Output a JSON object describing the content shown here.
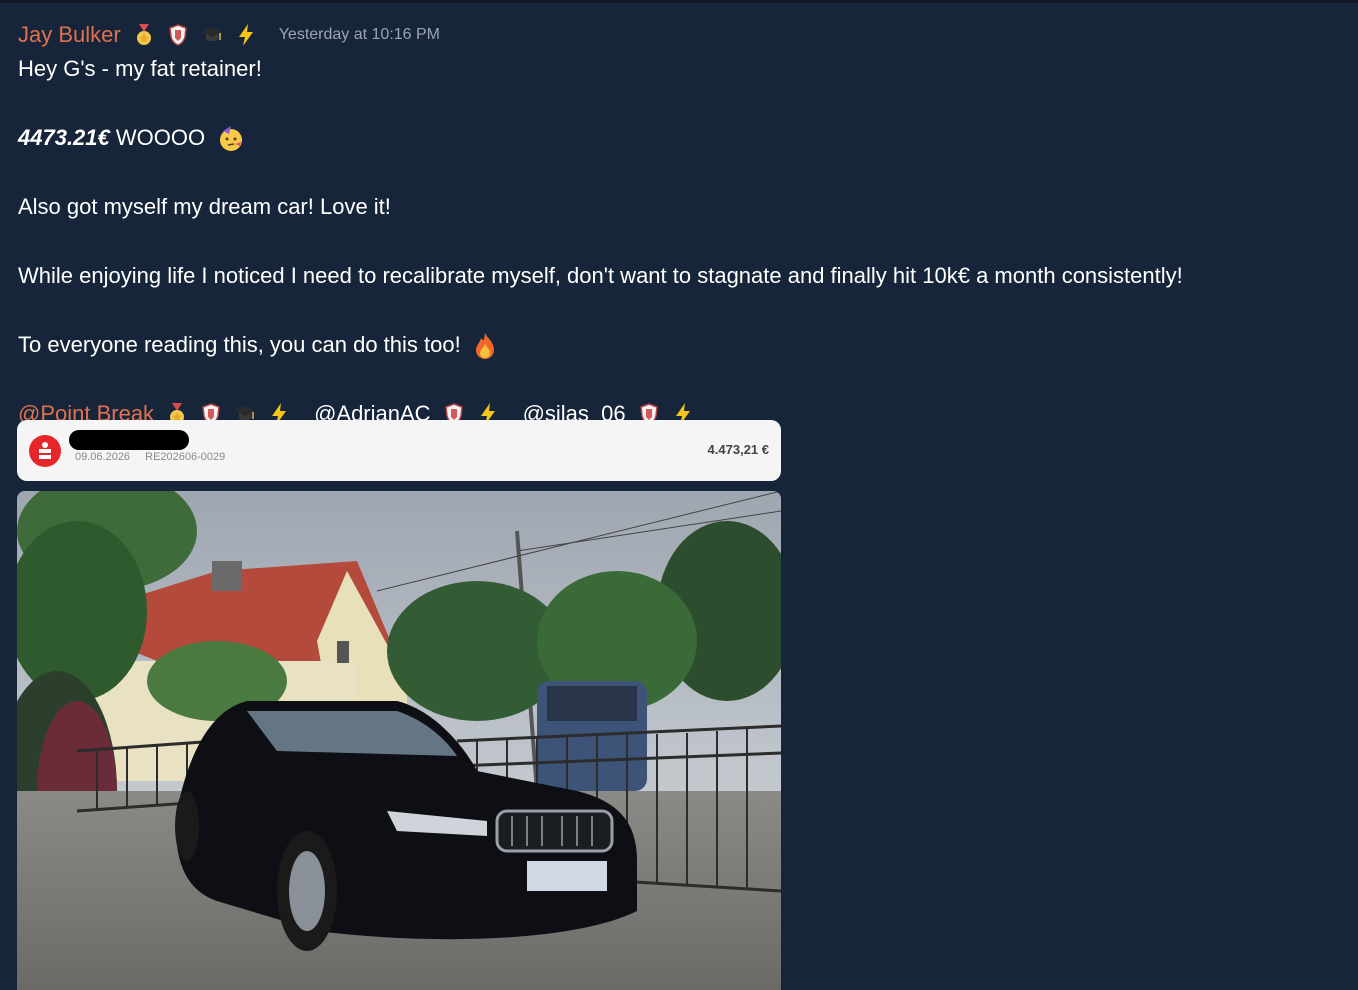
{
  "message": {
    "author": "Jay Bulker",
    "author_badges": [
      "medal-icon",
      "shield-icon",
      "graduation-cap-icon",
      "lightning-icon"
    ],
    "timestamp": "Yesterday at 10:16 PM",
    "line1": "Hey G's - my fat retainer!",
    "amount": "4473.21€",
    "amount_suffix": " WOOOO",
    "line3": "Also got myself my dream car! Love it!",
    "line4": "While enjoying life I noticed I need to recalibrate myself, don't want to stagnate and finally hit 10k€ a month consistently!",
    "line5": "To everyone reading this, you can do this too!",
    "mentions": [
      {
        "name": "@Point Break",
        "badges": [
          "medal-icon",
          "shield-icon",
          "graduation-cap-icon",
          "lightning-icon"
        ]
      },
      {
        "name": "@AdrianAC",
        "badges": [
          "shield-icon",
          "lightning-icon"
        ]
      },
      {
        "name": "@silas_06",
        "badges": [
          "shield-icon",
          "lightning-icon"
        ]
      }
    ]
  },
  "invoice": {
    "date": "09.06.2026",
    "reference": "RE202606-0029",
    "amount": "4.473,21 €"
  },
  "colors": {
    "background": "#16253a",
    "accent_orange": "#e0714f",
    "timestamp_gray": "#9aa4b3"
  }
}
